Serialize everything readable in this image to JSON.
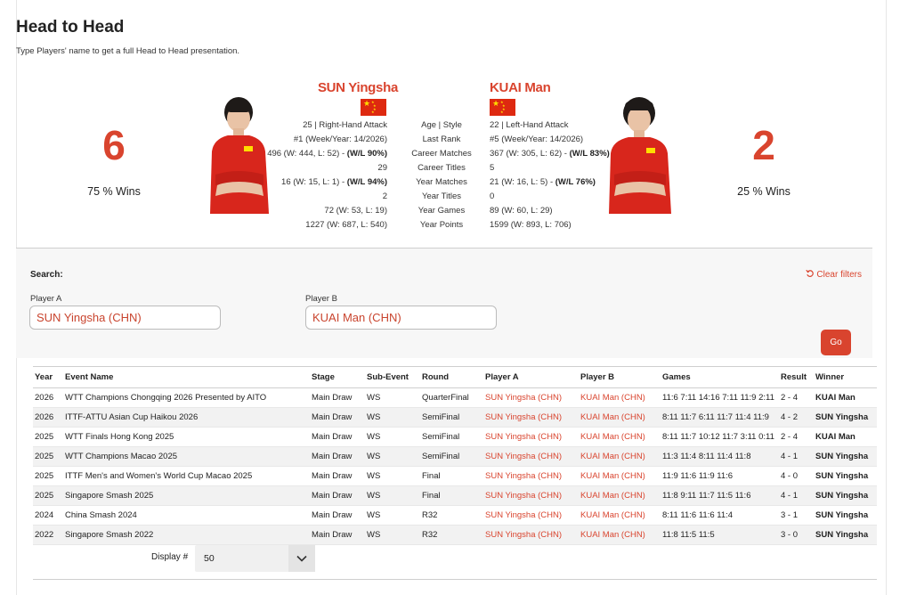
{
  "header": {
    "title": "Head to Head",
    "subtitle": "Type Players' name to get a full Head to Head presentation."
  },
  "player_a": {
    "name": "SUN Yingsha",
    "score": "6",
    "wins": "75 % Wins",
    "stats": [
      "25 | Right-Hand Attack",
      "#1 (Week/Year: 14/2026)",
      "496 (W: 444, L: 52) - ",
      "29",
      "16 (W: 15, L: 1) - ",
      "2",
      "72 (W: 53, L: 19)",
      "1227 (W: 687, L: 540)"
    ],
    "stats_bold": [
      "",
      "",
      "(W/L 90%)",
      "",
      "(W/L 94%)",
      "",
      "",
      ""
    ]
  },
  "player_b": {
    "name": "KUAI Man",
    "score": "2",
    "wins": "25 % Wins",
    "stats": [
      "22 | Left-Hand Attack",
      "#5 (Week/Year: 14/2026)",
      "367 (W: 305, L: 62) - ",
      "5",
      "21 (W: 16, L: 5) - ",
      "0",
      "89 (W: 60, L: 29)",
      "1599 (W: 893, L: 706)"
    ],
    "stats_bold": [
      "",
      "",
      "(W/L 83%)",
      "",
      "(W/L 76%)",
      "",
      "",
      ""
    ]
  },
  "stat_labels": [
    "Age | Style",
    "Last Rank",
    "Career Matches",
    "Career Titles",
    "Year Matches",
    "Year Titles",
    "Year Games",
    "Year Points"
  ],
  "search": {
    "label": "Search:",
    "clear": "Clear filters",
    "player_a_label": "Player A",
    "player_a_value": "SUN Yingsha (CHN)",
    "player_b_label": "Player B",
    "player_b_value": "KUAI Man (CHN)",
    "go": "Go"
  },
  "table": {
    "columns": [
      "Year",
      "Event Name",
      "Stage",
      "Sub-Event",
      "Round",
      "Player A",
      "Player B",
      "Games",
      "Result",
      "Winner"
    ],
    "rows": [
      [
        "2026",
        "WTT Champions Chongqing 2026 Presented by AITO",
        "Main Draw",
        "WS",
        "QuarterFinal",
        "SUN Yingsha (CHN)",
        "KUAI Man (CHN)",
        "11:6 7:11 14:16 7:11 11:9 2:11",
        "2 - 4",
        "KUAI Man"
      ],
      [
        "2026",
        "ITTF-ATTU Asian Cup Haikou 2026",
        "Main Draw",
        "WS",
        "SemiFinal",
        "SUN Yingsha (CHN)",
        "KUAI Man (CHN)",
        "8:11 11:7 6:11 11:7 11:4 11:9",
        "4 - 2",
        "SUN Yingsha"
      ],
      [
        "2025",
        "WTT Finals Hong Kong 2025",
        "Main Draw",
        "WS",
        "SemiFinal",
        "SUN Yingsha (CHN)",
        "KUAI Man (CHN)",
        "8:11 11:7 10:12 11:7 3:11 0:11",
        "2 - 4",
        "KUAI Man"
      ],
      [
        "2025",
        "WTT Champions Macao 2025",
        "Main Draw",
        "WS",
        "SemiFinal",
        "SUN Yingsha (CHN)",
        "KUAI Man (CHN)",
        "11:3 11:4 8:11 11:4 11:8",
        "4 - 1",
        "SUN Yingsha"
      ],
      [
        "2025",
        "ITTF Men's and Women's World Cup Macao 2025",
        "Main Draw",
        "WS",
        "Final",
        "SUN Yingsha (CHN)",
        "KUAI Man (CHN)",
        "11:9 11:6 11:9 11:6",
        "4 - 0",
        "SUN Yingsha"
      ],
      [
        "2025",
        "Singapore Smash 2025",
        "Main Draw",
        "WS",
        "Final",
        "SUN Yingsha (CHN)",
        "KUAI Man (CHN)",
        "11:8 9:11 11:7 11:5 11:6",
        "4 - 1",
        "SUN Yingsha"
      ],
      [
        "2024",
        "China Smash 2024",
        "Main Draw",
        "WS",
        "R32",
        "SUN Yingsha (CHN)",
        "KUAI Man (CHN)",
        "8:11 11:6 11:6 11:4",
        "3 - 1",
        "SUN Yingsha"
      ],
      [
        "2022",
        "Singapore Smash 2022",
        "Main Draw",
        "WS",
        "R32",
        "SUN Yingsha (CHN)",
        "KUAI Man (CHN)",
        "11:8 11:5 11:5",
        "3 - 0",
        "SUN Yingsha"
      ]
    ]
  },
  "display": {
    "label": "Display #",
    "value": "50"
  },
  "colors": {
    "accent": "#d9442e",
    "jersey": "#d8261c",
    "flag_red": "#de2910",
    "flag_star": "#ffde00"
  }
}
